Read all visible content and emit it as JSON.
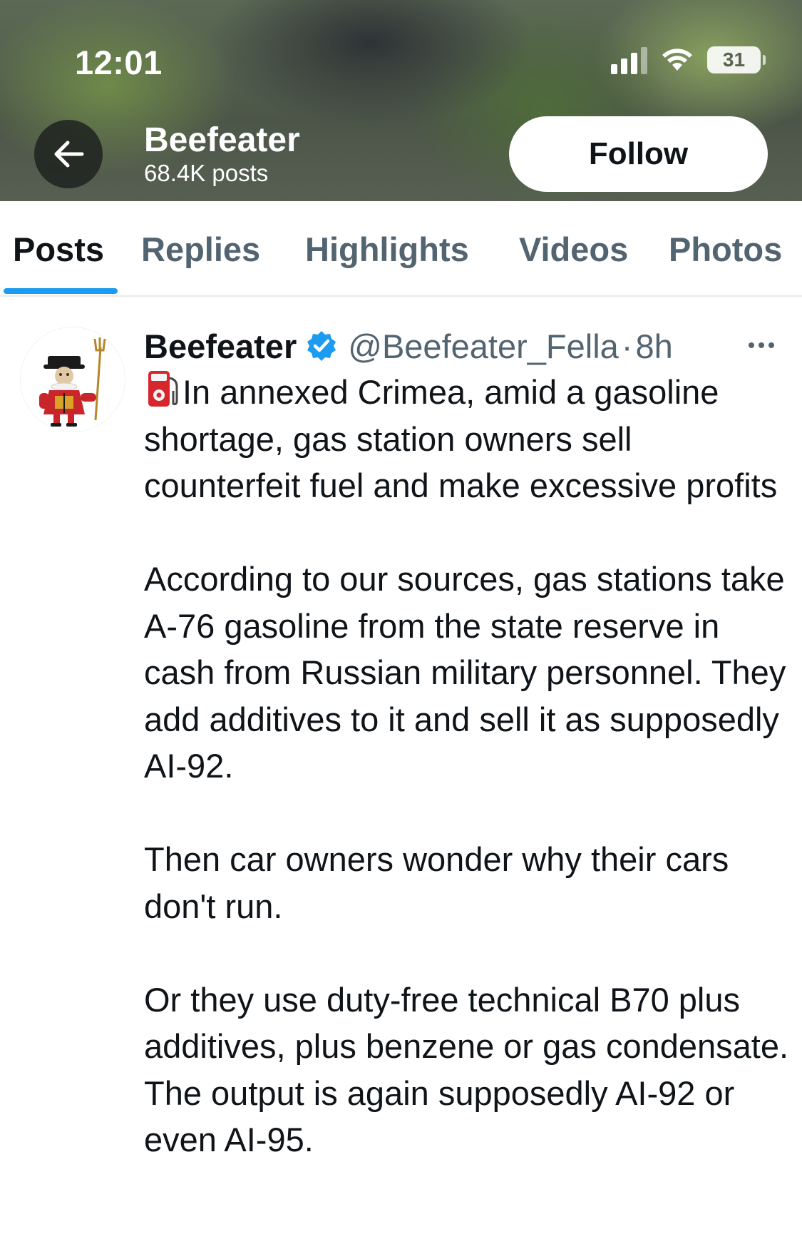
{
  "status_bar": {
    "time": "12:01",
    "battery": "31",
    "icons": [
      "cellular-signal-icon",
      "wifi-icon",
      "battery-icon"
    ]
  },
  "header": {
    "back_icon": "arrow-left-icon",
    "name": "Beefeater",
    "posts_count": "68.4K posts",
    "follow_label": "Follow"
  },
  "tabs": [
    {
      "label": "Posts",
      "active": true
    },
    {
      "label": "Replies",
      "active": false
    },
    {
      "label": "Highlights",
      "active": false
    },
    {
      "label": "Videos",
      "active": false
    },
    {
      "label": "Photos",
      "active": false
    }
  ],
  "post": {
    "author_name": "Beefeater",
    "verified_icon": "verified-badge-icon",
    "handle": "@Beefeater_Fella",
    "separator": "·",
    "time": "8h",
    "more_icon": "more-horizontal-icon",
    "emoji": "fuel-pump-emoji",
    "paragraphs": [
      "In annexed Crimea, amid a gasoline shortage, gas station owners sell counterfeit fuel and make excessive profits",
      "According to our sources, gas stations take A-76 gasoline from the state reserve in cash from Russian military personnel. They add additives to it and sell it as supposedly AI-92.",
      "Then car owners wonder why their cars don't run.",
      "Or they use duty-free technical B70 plus additives, plus benzene or gas condensate. The output is again supposedly AI-92 or even AI-95."
    ]
  },
  "colors": {
    "accent": "#1d9bf0",
    "text_primary": "#0f1419",
    "text_secondary": "#536471"
  }
}
